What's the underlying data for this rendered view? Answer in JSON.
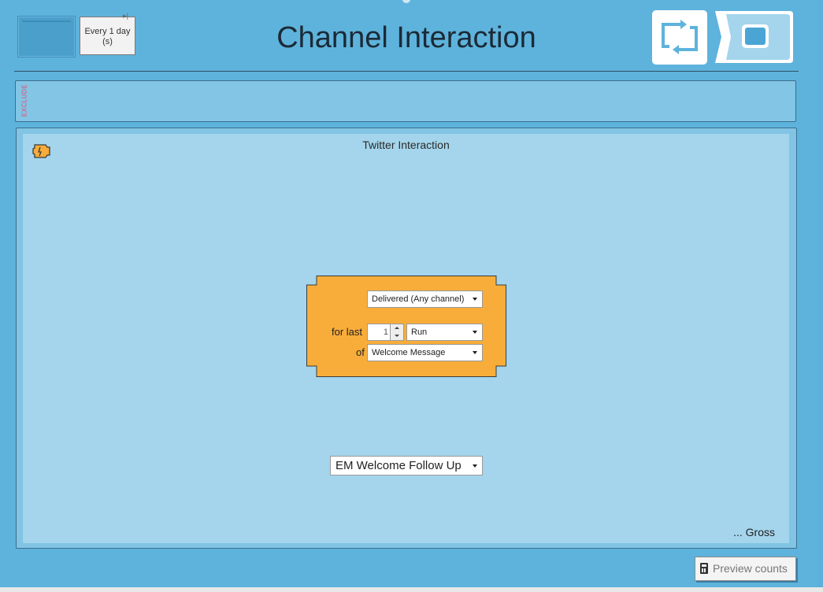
{
  "header": {
    "schedule_label": "Every 1 day (s)",
    "title": "Channel Interaction"
  },
  "exclude": {
    "label": "EXCLUDE"
  },
  "panel": {
    "title": "Twitter Interaction",
    "interaction_select": "Delivered (Any channel)",
    "for_last_label": "for last",
    "period_value": "1",
    "period_unit": "Run",
    "of_label": "of",
    "message_select": "Welcome Message",
    "campaign_select": "EM Welcome Follow Up",
    "gross_label": "... Gross"
  },
  "footer": {
    "preview_counts": "Preview counts"
  },
  "icons": {
    "loop": "loop-arrows-icon",
    "screen": "screen-icon",
    "puzzle": "puzzle-icon",
    "calculator": "calculator-icon"
  },
  "colors": {
    "background": "#5eb3dc",
    "panel": "#a4d5ec",
    "block": "#f8ad3a",
    "exclude_label": "#e34a6f"
  }
}
